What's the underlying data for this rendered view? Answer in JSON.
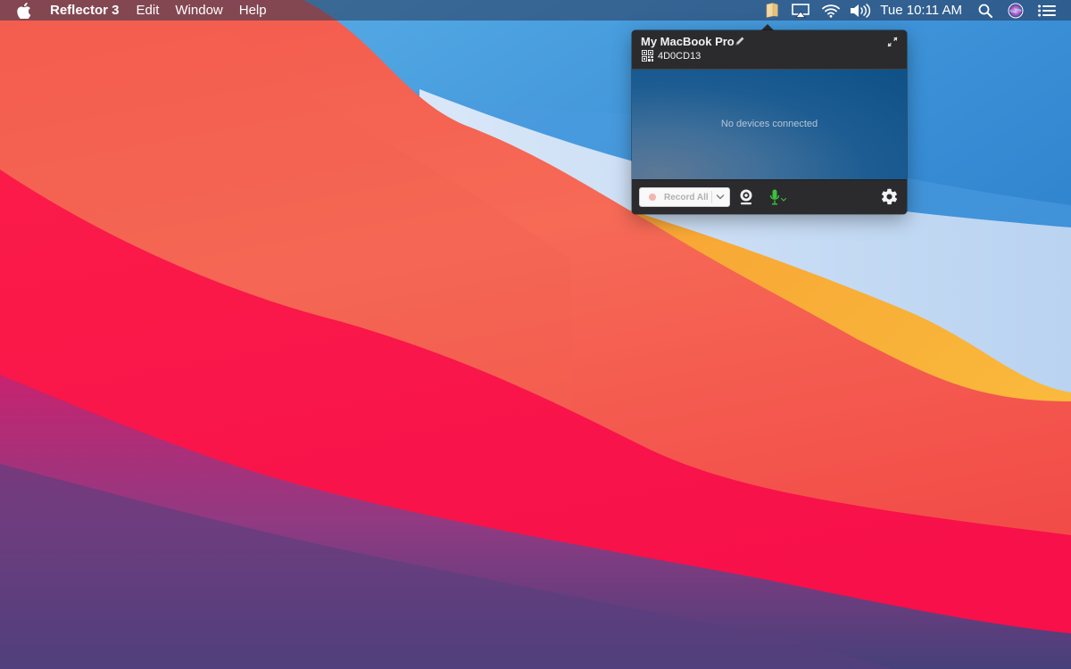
{
  "menubar": {
    "app_name": "Reflector 3",
    "menus": [
      "Edit",
      "Window",
      "Help"
    ],
    "clock": "Tue 10:11 AM",
    "status_icons": [
      "reflector-icon",
      "airplay-icon",
      "wifi-icon",
      "volume-icon",
      "search-icon",
      "siri-icon",
      "control-center-icon"
    ]
  },
  "popover": {
    "device_name": "My MacBook Pro",
    "device_code": "4D0CD13",
    "empty_message": "No devices connected",
    "record_label": "Record All"
  },
  "colors": {
    "popover_bg": "#2b2b2d",
    "preview_bg": "#1c5c92",
    "mic_accent": "#3cc23c",
    "record_dot": "#f7b3b0"
  }
}
